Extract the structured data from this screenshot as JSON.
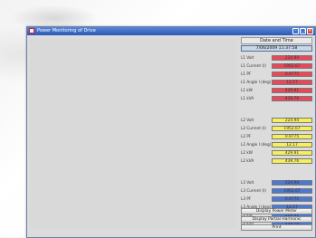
{
  "window": {
    "title": "Power Monitoring of Drive"
  },
  "right_panel": {
    "date_time_label": "Date and Time",
    "date_time_value": "7/06/2009 11:37:58"
  },
  "groups": [
    {
      "color": "#e8485a",
      "rows": [
        {
          "label": "L1 Volt",
          "value": "224.94"
        },
        {
          "label": "L1 Current (I)",
          "value": "1952.67"
        },
        {
          "label": "L1 PF",
          "value": "0.9775"
        },
        {
          "label": "L1 Angle I (deg)",
          "value": "12.17"
        },
        {
          "label": "L1 kW",
          "value": "429.91"
        },
        {
          "label": "L1 kVA",
          "value": "439.76"
        }
      ]
    },
    {
      "color": "#f6ef5a",
      "rows": [
        {
          "label": "L2 Volt",
          "value": "224.94"
        },
        {
          "label": "L2 Current (I)",
          "value": "1952.67"
        },
        {
          "label": "L2 PF",
          "value": "0.9775"
        },
        {
          "label": "L2 Angle I (deg)",
          "value": "12.17"
        },
        {
          "label": "L2 kW",
          "value": "429.91"
        },
        {
          "label": "L2 kVA",
          "value": "439.76"
        }
      ]
    },
    {
      "color": "#4a78d6",
      "rows": [
        {
          "label": "L3 Volt",
          "value": "224.94"
        },
        {
          "label": "L3 Current (I)",
          "value": "1952.67"
        },
        {
          "label": "L3 PF",
          "value": "0.9775"
        },
        {
          "label": "L3 Angle I (deg)",
          "value": "12.17"
        },
        {
          "label": "L3 kW",
          "value": "429.91"
        },
        {
          "label": "L3 kVA",
          "value": "439.76"
        }
      ]
    }
  ],
  "buttons": {
    "power_meter": "Display Power Meter",
    "harmonic": "Display Partial Harmonic",
    "print": "Print"
  },
  "phasor": {
    "l1_angle": 95,
    "l2_angle": 215,
    "l3_angle": -25,
    "colors": {
      "l1": "#e0353f",
      "l2": "#f0e63a",
      "l3": "#3f63d2"
    }
  }
}
